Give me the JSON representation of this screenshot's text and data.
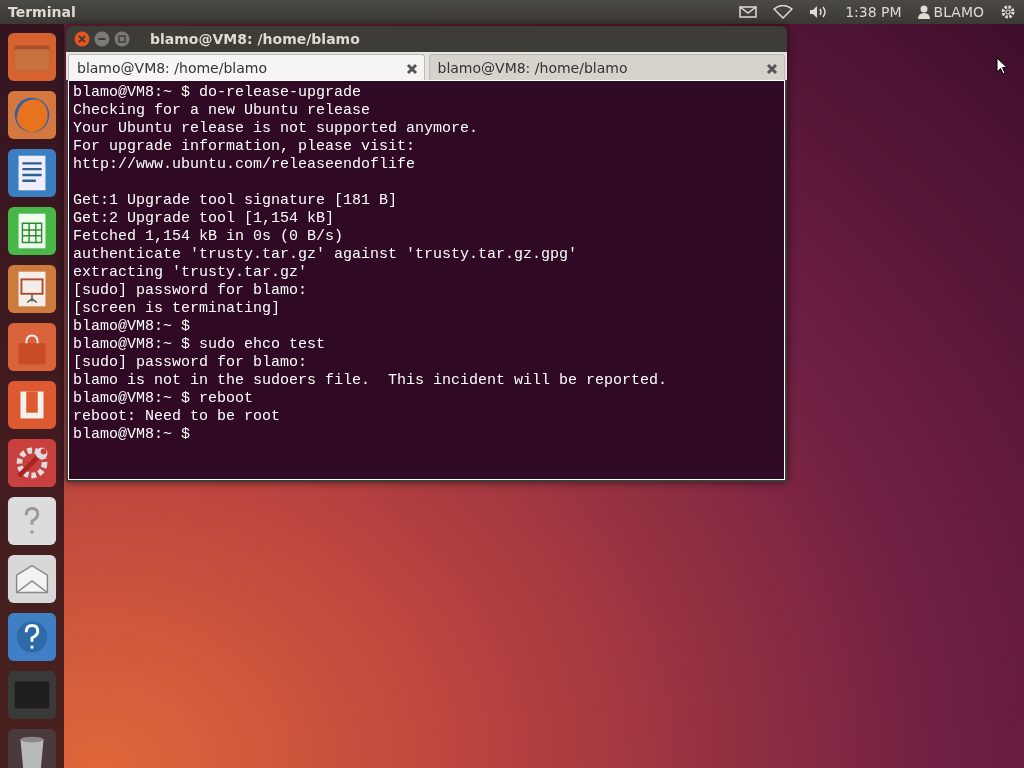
{
  "top_panel": {
    "app_name": "Terminal",
    "clock": "1:38 PM",
    "user": "BLAMO"
  },
  "window": {
    "title": "blamo@VM8: /home/blamo",
    "tabs": [
      {
        "label": "blamo@VM8: /home/blamo",
        "selected": true
      },
      {
        "label": "blamo@VM8: /home/blamo",
        "selected": false
      }
    ],
    "output_blocks": [
      [
        "blamo@VM8:~ $ do-release-upgrade",
        "Checking for a new Ubuntu release",
        "Your Ubuntu release is not supported anymore.",
        "For upgrade information, please visit:",
        "http://www.ubuntu.com/releaseendoflife"
      ],
      [
        "Get:1 Upgrade tool signature [181 B]",
        "Get:2 Upgrade tool [1,154 kB]",
        "Fetched 1,154 kB in 0s (0 B/s)",
        "authenticate 'trusty.tar.gz' against 'trusty.tar.gz.gpg'",
        "extracting 'trusty.tar.gz'",
        "[sudo] password for blamo:",
        "[screen is terminating]",
        "blamo@VM8:~ $",
        "blamo@VM8:~ $ sudo ehco test",
        "[sudo] password for blamo:",
        "blamo is not in the sudoers file.  This incident will be reported.",
        "blamo@VM8:~ $ reboot",
        "reboot: Need to be root",
        "blamo@VM8:~ $"
      ]
    ]
  }
}
